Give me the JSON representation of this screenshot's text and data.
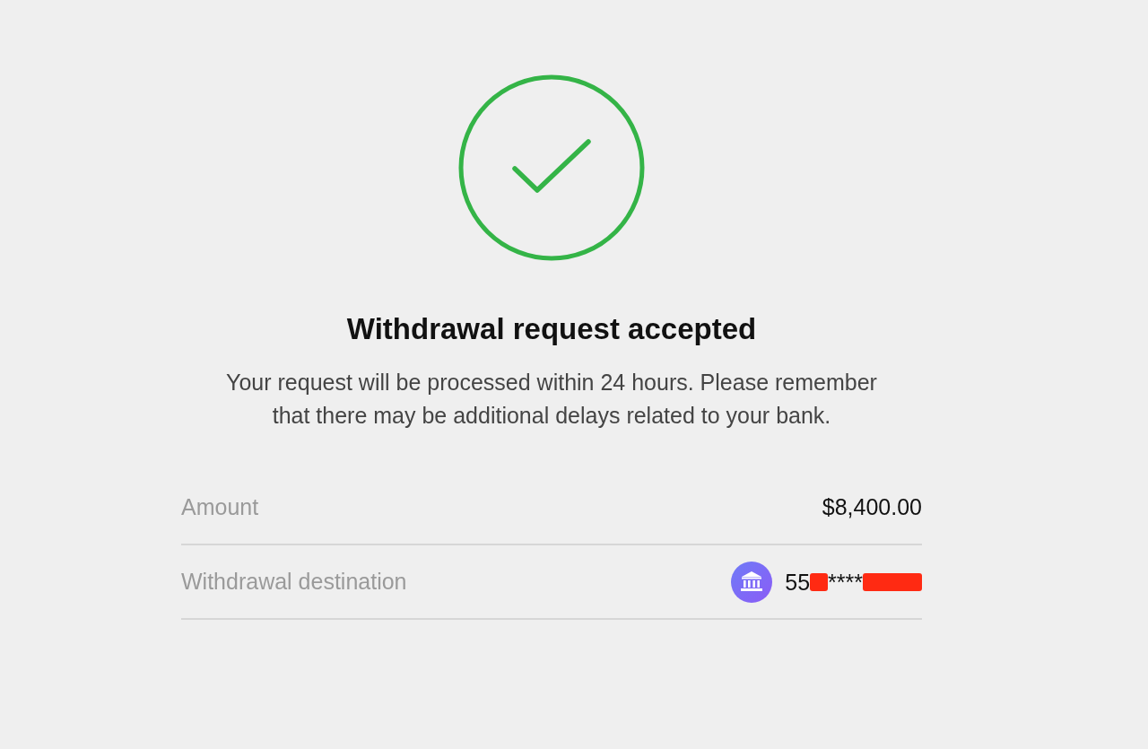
{
  "title": "Withdrawal request accepted",
  "message": "Your request will be processed within 24 hours. Please remember that there may be additional delays related to your bank.",
  "details": [
    {
      "kind": "amount",
      "label": "Amount",
      "value": "$8,400.00"
    },
    {
      "kind": "destination",
      "label": "Withdrawal destination",
      "parts": [
        {
          "kind": "text",
          "text": "55"
        },
        {
          "kind": "redaction"
        },
        {
          "kind": "text",
          "text": "****"
        },
        {
          "kind": "redaction"
        }
      ]
    }
  ]
}
